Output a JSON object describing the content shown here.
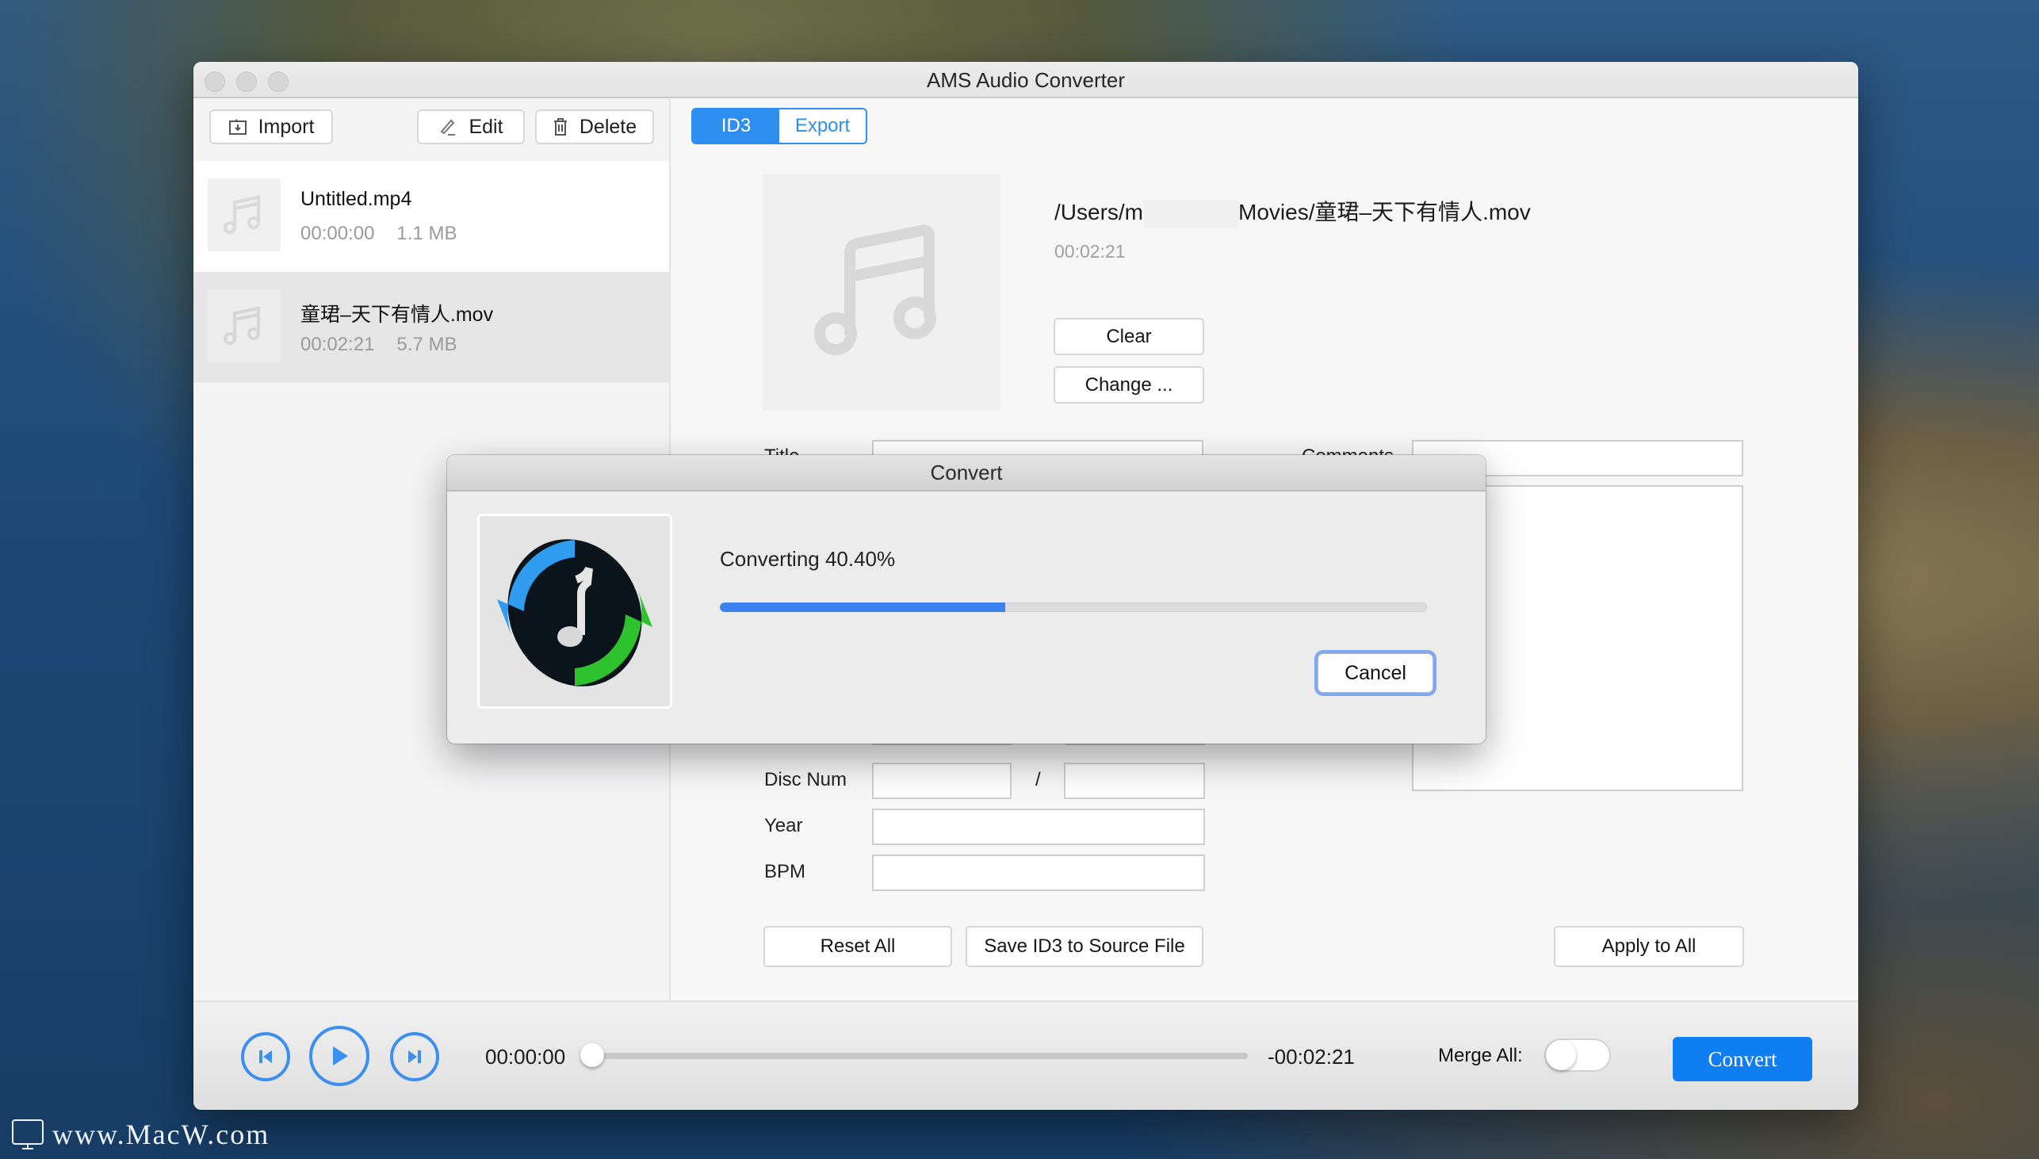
{
  "window": {
    "title": "AMS Audio Converter"
  },
  "toolbar": {
    "import_label": "Import",
    "edit_label": "Edit",
    "delete_label": "Delete"
  },
  "file_list": [
    {
      "name": "Untitled.mp4",
      "duration": "00:00:00",
      "size": "1.1 MB",
      "selected": false
    },
    {
      "name": "童珺–天下有情人.mov",
      "duration": "00:02:21",
      "size": "5.7 MB",
      "selected": true
    }
  ],
  "tabs": [
    {
      "label": "ID3",
      "active": true
    },
    {
      "label": "Export",
      "active": false
    }
  ],
  "detail": {
    "path_prefix": "/Users/m",
    "path_suffix": "Movies/童珺–天下有情人.mov",
    "duration": "00:02:21",
    "clear_label": "Clear",
    "change_label": "Change ..."
  },
  "form": {
    "title_label": "Title",
    "comments_label": "Comments",
    "disc_num_label": "Disc Num",
    "disc_separator": "/",
    "year_label": "Year",
    "bpm_label": "BPM",
    "title_value": "",
    "comments_value": "",
    "disc_num_value": "",
    "disc_total_value": "",
    "year_value": "",
    "bpm_value": ""
  },
  "actions": {
    "reset_all": "Reset All",
    "save_id3": "Save ID3 to Source File",
    "apply_all": "Apply to All"
  },
  "player": {
    "current_time": "00:00:00",
    "remaining_time": "-00:02:21",
    "position_fraction": 0.0,
    "merge_label": "Merge All:",
    "merge_on": false,
    "convert_label": "Convert"
  },
  "dialog": {
    "title": "Convert",
    "status": "Converting 40.40%",
    "progress_percent": 40.4,
    "cancel_label": "Cancel"
  },
  "colors": {
    "accent": "#2d8ef0",
    "convert_button": "#0e7ef0",
    "progress_fill": "#3b82f0"
  },
  "watermark": "www.MacW.com"
}
